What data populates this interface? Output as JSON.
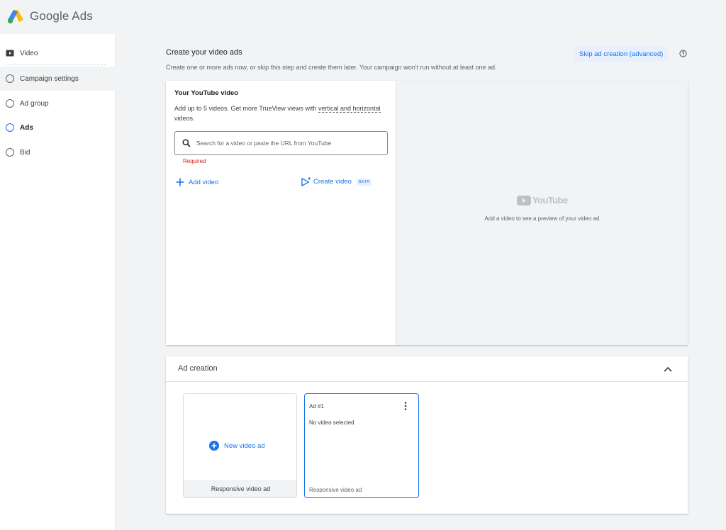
{
  "app": {
    "title": "Google Ads"
  },
  "sidebar": {
    "items": [
      {
        "label": "Video"
      },
      {
        "label": "Campaign settings"
      },
      {
        "label": "Ad group"
      },
      {
        "label": "Ads"
      },
      {
        "label": "Bid"
      }
    ]
  },
  "main": {
    "title": "Create your video ads",
    "subtitle": "Create one or more ads now, or skip this step and create them later. Your campaign won't run without at least one ad.",
    "skip_label": "Skip ad creation (advanced)"
  },
  "video_panel": {
    "title": "Your YouTube video",
    "desc_part1": "Add up to 5 videos. Get more TrueView views with ",
    "desc_link": "vertical and horizontal",
    "desc_part2": " videos.",
    "search_placeholder": "Search for a video or paste the URL from YouTube",
    "required": "Required",
    "add_video": "Add video",
    "create_video": "Create video",
    "beta": "BETA",
    "youtube_word": "YouTube",
    "preview_text": "Add a video to see a preview of your video ad"
  },
  "ad_creation": {
    "title": "Ad creation",
    "new_ad_label": "New video ad",
    "new_ad_footer": "Responsive video ad",
    "ad_card": {
      "name": "Ad #1",
      "status": "No video selected",
      "type": "Responsive video ad"
    }
  },
  "colors": {
    "accent": "#1a73e8",
    "error": "#c5221f",
    "background": "#f1f3f4"
  },
  "icons": [
    "google-ads-logo",
    "video-icon",
    "help-icon",
    "search-icon",
    "add-icon",
    "create-video-icon",
    "youtube-play-icon",
    "chevron-up-icon",
    "more-vert-icon",
    "add-circle-icon"
  ]
}
